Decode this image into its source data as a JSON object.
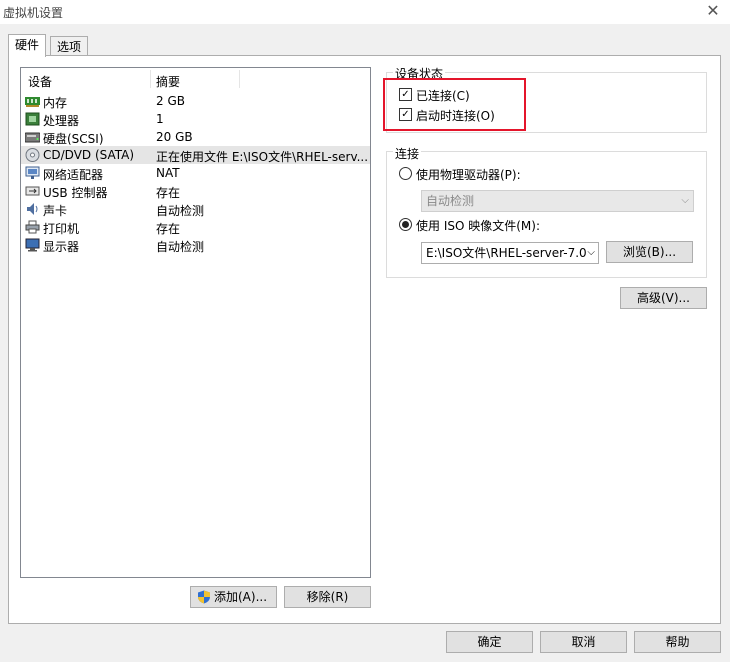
{
  "window": {
    "title": "虚拟机设置",
    "close_glyph": "✕"
  },
  "tabs": [
    {
      "label": "硬件"
    },
    {
      "label": "选项"
    }
  ],
  "device_list": {
    "columns": [
      "设备",
      "摘要"
    ],
    "rows": [
      {
        "device": "内存",
        "summary": "2 GB",
        "icon": "memory-icon"
      },
      {
        "device": "处理器",
        "summary": "1",
        "icon": "processor-icon"
      },
      {
        "device": "硬盘(SCSI)",
        "summary": "20 GB",
        "icon": "hard-disk-icon"
      },
      {
        "device": "CD/DVD (SATA)",
        "summary": "正在使用文件 E:\\ISO文件\\RHEL-serv...",
        "icon": "cd-dvd-icon"
      },
      {
        "device": "网络适配器",
        "summary": "NAT",
        "icon": "network-adapter-icon"
      },
      {
        "device": "USB 控制器",
        "summary": "存在",
        "icon": "usb-icon"
      },
      {
        "device": "声卡",
        "summary": "自动检测",
        "icon": "sound-card-icon"
      },
      {
        "device": "打印机",
        "summary": "存在",
        "icon": "printer-icon"
      },
      {
        "device": "显示器",
        "summary": "自动检测",
        "icon": "display-icon"
      }
    ],
    "selected_index": 3
  },
  "list_buttons": {
    "add": "添加(A)...",
    "remove": "移除(R)"
  },
  "device_status": {
    "legend": "设备状态",
    "connected": {
      "label": "已连接(C)",
      "checked": true
    },
    "connect_at_power_on": {
      "label": "启动时连接(O)",
      "checked": true
    }
  },
  "connection": {
    "legend": "连接",
    "physical": {
      "label": "使用物理驱动器(P):",
      "selected": false
    },
    "physical_drive_value": "自动检测",
    "iso": {
      "label": "使用 ISO 映像文件(M):",
      "selected": true
    },
    "iso_path": "E:\\ISO文件\\RHEL-server-7.0",
    "browse": "浏览(B)..."
  },
  "advanced": "高级(V)...",
  "footer": {
    "ok": "确定",
    "cancel": "取消",
    "help": "帮助"
  },
  "colors": {
    "highlight_box": "#e4152b"
  }
}
